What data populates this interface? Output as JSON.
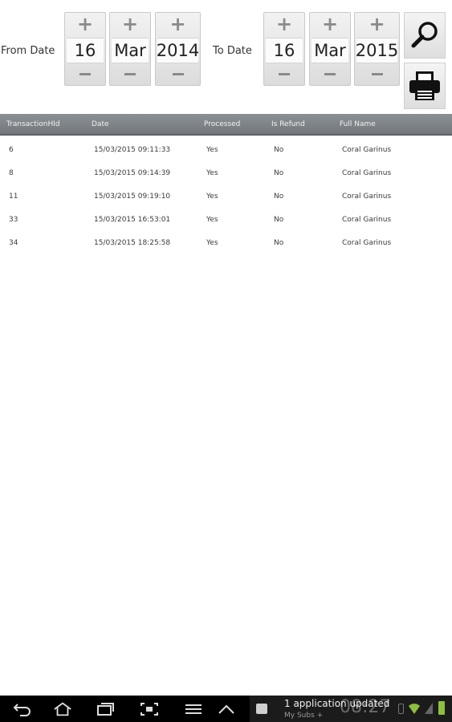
{
  "from": {
    "label": "From Date",
    "day": "16",
    "month": "Mar",
    "year": "2014"
  },
  "to": {
    "label": "To Date",
    "day": "16",
    "month": "Mar",
    "year": "2015"
  },
  "picker": {
    "inc_symbol": "+",
    "dec_symbol": "−"
  },
  "actions": {
    "search_icon": "magnifier-icon",
    "print_icon": "printer-icon"
  },
  "table": {
    "headers": [
      "TransactionHId",
      "Date",
      "Processed",
      "Is Refund",
      "Full Name"
    ],
    "rows": [
      [
        "6",
        "15/03/2015 09:11:33",
        "Yes",
        "No",
        "Coral Garinus"
      ],
      [
        "8",
        "15/03/2015 09:14:39",
        "Yes",
        "No",
        "Coral Garinus"
      ],
      [
        "11",
        "15/03/2015 09:19:10",
        "Yes",
        "No",
        "Coral Garinus"
      ],
      [
        "33",
        "15/03/2015 16:53:01",
        "Yes",
        "No",
        "Coral Garinus"
      ],
      [
        "34",
        "15/03/2015 18:25:58",
        "Yes",
        "No",
        "Coral Garinus"
      ]
    ]
  },
  "statusbar": {
    "notification_title": "1 application updated",
    "notification_sub": "My Subs +",
    "clock": "08:27"
  },
  "colors": {
    "header_bg": "#7d8287",
    "navbar_bg": "#000000"
  }
}
